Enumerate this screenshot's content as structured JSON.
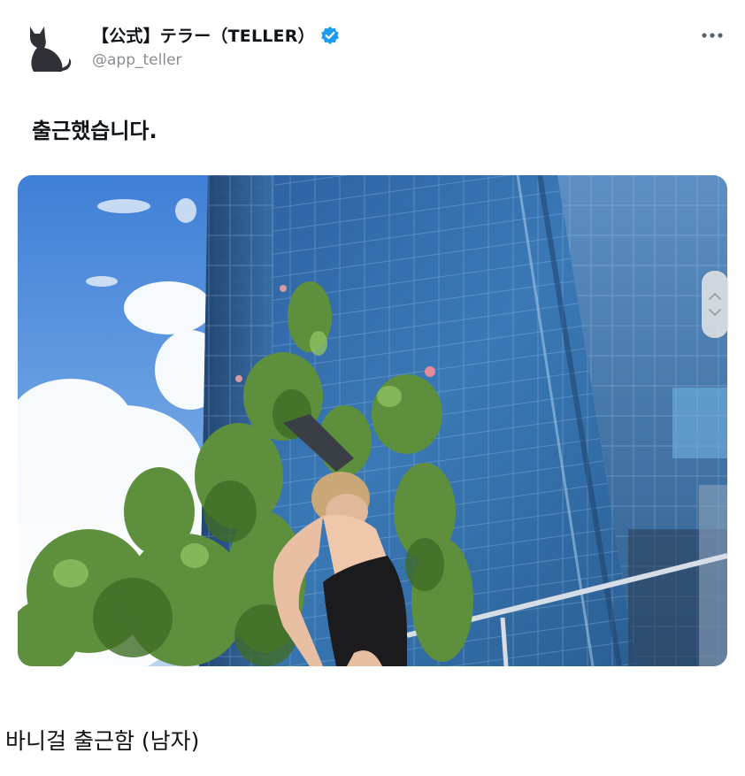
{
  "author": {
    "display_name": "【公式】テラー（TELLER）",
    "handle": "@app_teller",
    "avatar_icon": "cat-silhouette-icon",
    "verified": true
  },
  "tweet": {
    "text": "출근했습니다."
  },
  "media": {
    "description_icon": "photo-icon"
  },
  "caption": {
    "text": "바니걸 출근함 (남자)"
  },
  "colors": {
    "verified_blue": "#1d9bf0",
    "handle_gray": "#888d92",
    "sky_blue": "#4a86d6"
  }
}
